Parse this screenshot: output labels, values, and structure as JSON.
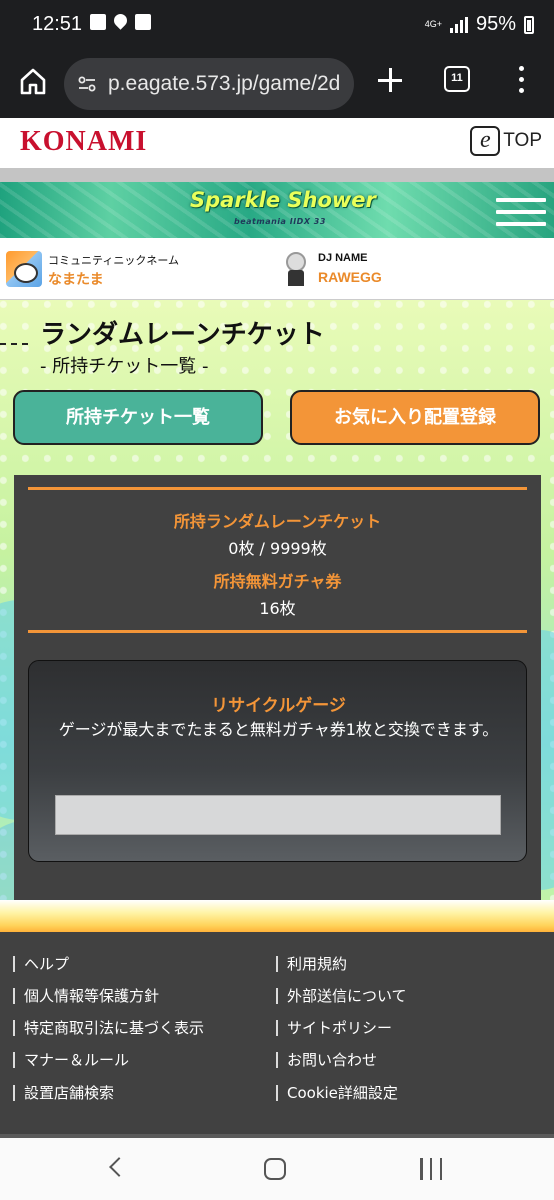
{
  "status_bar": {
    "time": "12:51",
    "network": "4G+",
    "battery": "95%",
    "icons": [
      "image-icon",
      "location-icon",
      "checkbox-icon",
      "signal-icon",
      "battery-icon"
    ]
  },
  "browser": {
    "url": "p.eagate.573.jp/game/2d",
    "tab_count": "11"
  },
  "header": {
    "konami_logo": "KONAMI",
    "etop_mark": "e",
    "etop_label": "TOP"
  },
  "banner": {
    "logo_title": "Sparkle Shower",
    "logo_subtitle": "beatmania IIDX 33"
  },
  "profile": {
    "community_label": "コミュニティニックネーム",
    "community_value": "なまたま",
    "dj_label": "DJ NAME",
    "dj_value": "RAWEGG"
  },
  "page": {
    "title": "ランダムレーンチケット",
    "subtitle": "- 所持チケット一覧 -"
  },
  "buttons": {
    "ticket_list": "所持チケット一覧",
    "favorite_register": "お気に入り配置登録"
  },
  "tickets": {
    "random_lane_label": "所持ランダムレーンチケット",
    "random_lane_value": "0枚 / 9999枚",
    "gacha_label": "所持無料ガチャ券",
    "gacha_value": "16枚"
  },
  "recycle_gauge": {
    "title": "リサイクルゲージ",
    "description": "ゲージが最大までたまると無料ガチャ券1枚と交換できます。",
    "fill_fraction": 0
  },
  "footer": {
    "left_links": [
      "ヘルプ",
      "個人情報等保護方針",
      "特定商取引法に基づく表示",
      "マナー＆ルール",
      "設置店舗検索"
    ],
    "right_links": [
      "利用規約",
      "外部送信について",
      "サイトポリシー",
      "お問い合わせ",
      "Cookie詳細設定"
    ]
  },
  "colors": {
    "accent_orange": "#f39538",
    "accent_green": "#4ab399",
    "konami_red": "#c8102e",
    "panel_dark": "#414141"
  }
}
